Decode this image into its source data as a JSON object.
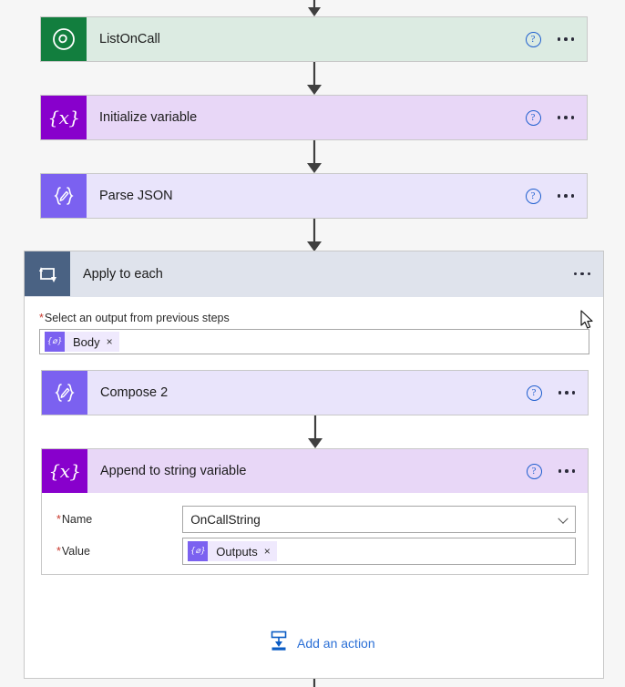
{
  "flow": {
    "steps": [
      {
        "id": "listoncall",
        "title": "ListOnCall",
        "icon": "connector-ring-icon",
        "theme": "green",
        "help_label": "?",
        "menu_label": "⋯"
      },
      {
        "id": "initialize-variable",
        "title": "Initialize variable",
        "icon": "variable-braces-x-icon",
        "theme": "purple",
        "help_label": "?",
        "menu_label": "⋯"
      },
      {
        "id": "parse-json",
        "title": "Parse JSON",
        "icon": "data-operation-braces-icon",
        "theme": "lilac",
        "help_label": "?",
        "menu_label": "⋯"
      }
    ],
    "scope": {
      "id": "apply-to-each",
      "title": "Apply to each",
      "icon": "loop-arrow-icon",
      "menu_label": "⋯",
      "output_field": {
        "required_marker": "*",
        "label": "Select an output from previous steps",
        "token": {
          "label": "Body",
          "icon": "data-operation-braces-icon",
          "remove_label": "×"
        }
      },
      "children": [
        {
          "id": "compose-2",
          "title": "Compose 2",
          "icon": "data-operation-braces-icon",
          "theme": "lilac",
          "help_label": "?",
          "menu_label": "⋯"
        },
        {
          "id": "append-to-string-variable",
          "title": "Append to string variable",
          "icon": "variable-braces-x-icon",
          "theme": "purple",
          "help_label": "?",
          "menu_label": "⋯",
          "fields": [
            {
              "id": "name",
              "required_marker": "*",
              "label": "Name",
              "value": "OnCallString",
              "control": "dropdown"
            },
            {
              "id": "value",
              "required_marker": "*",
              "label": "Value",
              "control": "token",
              "token": {
                "label": "Outputs",
                "icon": "data-operation-braces-icon",
                "remove_label": "×"
              }
            }
          ]
        }
      ],
      "add_action": {
        "label": "Add an action",
        "icon": "insert-below-icon"
      }
    }
  },
  "colors": {
    "canvas_background": "#f6f6f6",
    "green_icon": "#127e3e",
    "green_body": "#dcebe2",
    "purple_icon": "#8800cc",
    "purple_body": "#e8d7f7",
    "lilac_icon": "#7b61f0",
    "lilac_body": "#e9e4fb",
    "scope_header": "#dfe3ec",
    "scope_icon": "#4a6283",
    "link_blue": "#2a6fd6",
    "required_red": "#c9382c",
    "connector_gray": "#3f3f3f"
  }
}
